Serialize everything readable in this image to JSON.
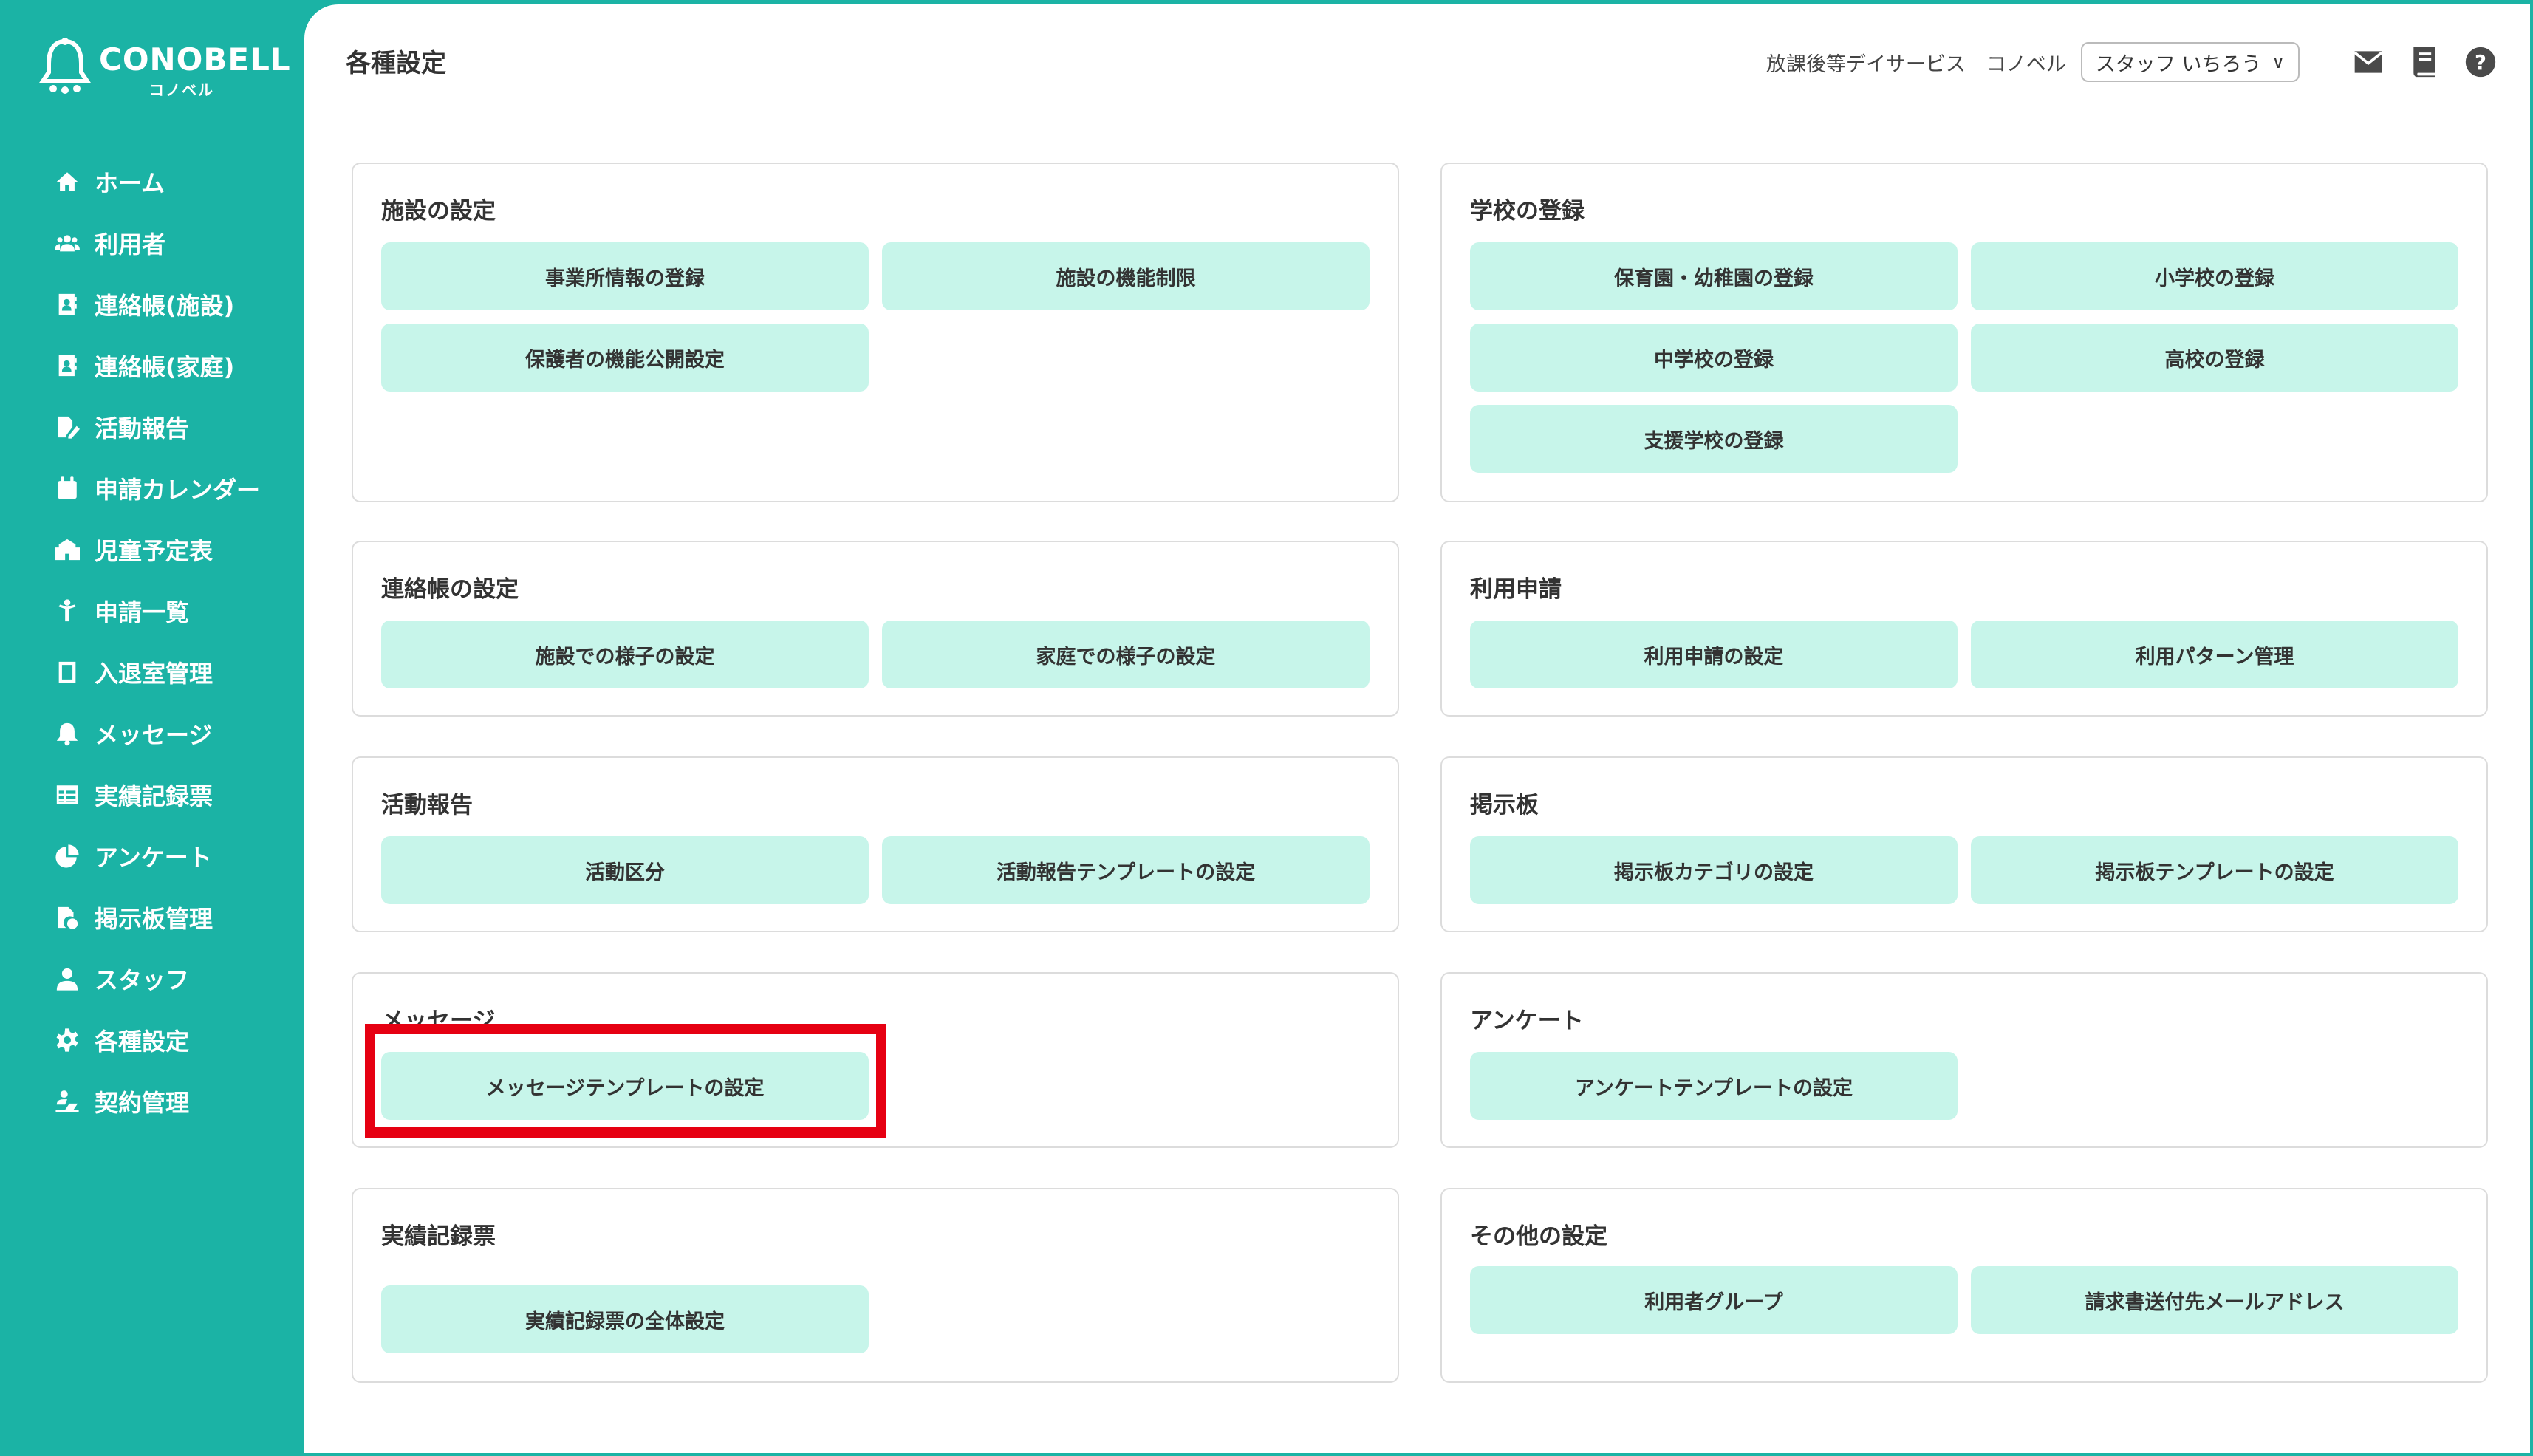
{
  "app": {
    "logo_text": "CONOBELL",
    "logo_sub": "コノベル"
  },
  "sidebar": {
    "items": [
      {
        "label": "ホーム",
        "icon": "home-icon"
      },
      {
        "label": "利用者",
        "icon": "users-icon"
      },
      {
        "label": "連絡帳(施設)",
        "icon": "contact-book-icon"
      },
      {
        "label": "連絡帳(家庭)",
        "icon": "contact-book-icon"
      },
      {
        "label": "活動報告",
        "icon": "report-edit-icon"
      },
      {
        "label": "申請カレンダー",
        "icon": "calendar-icon"
      },
      {
        "label": "児童予定表",
        "icon": "school-icon"
      },
      {
        "label": "申請一覧",
        "icon": "person-icon"
      },
      {
        "label": "入退室管理",
        "icon": "door-icon"
      },
      {
        "label": "メッセージ",
        "icon": "bell-icon"
      },
      {
        "label": "実績記録票",
        "icon": "table-icon"
      },
      {
        "label": "アンケート",
        "icon": "pie-chart-icon"
      },
      {
        "label": "掲示板管理",
        "icon": "board-file-icon"
      },
      {
        "label": "スタッフ",
        "icon": "staff-icon"
      },
      {
        "label": "各種設定",
        "icon": "gear-icon"
      },
      {
        "label": "契約管理",
        "icon": "contract-icon"
      }
    ]
  },
  "header": {
    "title": "各種設定",
    "facility": "放課後等デイサービス",
    "org": "コノベル",
    "staff_select": "スタッフ いちろう"
  },
  "cards": {
    "facility": {
      "title": "施設の設定",
      "buttons": [
        "事業所情報の登録",
        "施設の機能制限",
        "保護者の機能公開設定"
      ]
    },
    "school": {
      "title": "学校の登録",
      "buttons": [
        "保育園・幼稚園の登録",
        "小学校の登録",
        "中学校の登録",
        "高校の登録",
        "支援学校の登録"
      ]
    },
    "contact": {
      "title": "連絡帳の設定",
      "buttons": [
        "施設での様子の設定",
        "家庭での様子の設定"
      ]
    },
    "usage": {
      "title": "利用申請",
      "buttons": [
        "利用申請の設定",
        "利用パターン管理"
      ]
    },
    "activity": {
      "title": "活動報告",
      "buttons": [
        "活動区分",
        "活動報告テンプレートの設定"
      ]
    },
    "board": {
      "title": "掲示板",
      "buttons": [
        "掲示板カテゴリの設定",
        "掲示板テンプレートの設定"
      ]
    },
    "message": {
      "title": "メッセージ",
      "buttons": [
        "メッセージテンプレートの設定"
      ]
    },
    "survey": {
      "title": "アンケート",
      "buttons": [
        "アンケートテンプレートの設定"
      ]
    },
    "record": {
      "title": "実績記録票",
      "buttons": [
        "実績記録票の全体設定"
      ]
    },
    "other": {
      "title": "その他の設定",
      "buttons": [
        "利用者グループ",
        "請求書送付先メールアドレス"
      ]
    }
  },
  "colors": {
    "brand": "#1bb3a5",
    "button_bg": "#c7f5ea",
    "highlight": "#e60012"
  }
}
